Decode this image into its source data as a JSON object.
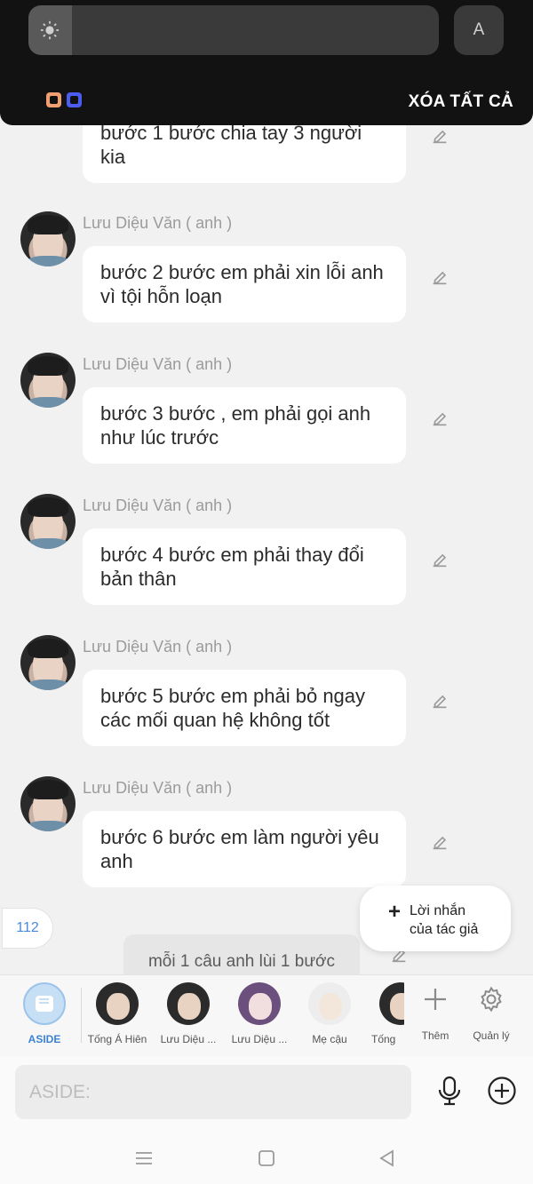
{
  "notification_shade": {
    "auto_label": "A",
    "clear_all_label": "XÓA TẤT CẢ",
    "icons": [
      "sun-icon",
      "app-icon-orange",
      "app-icon-blue"
    ]
  },
  "messages": [
    {
      "sender": "",
      "text": "bước 1 bước chia tay  3 người kia"
    },
    {
      "sender": "Lưu Diệu Văn ( anh )",
      "text": "bước 2 bước em phải xin lỗi anh vì tội hỗn loạn"
    },
    {
      "sender": "Lưu Diệu Văn ( anh )",
      "text": "bước 3 bước , em phải gọi anh như lúc trước"
    },
    {
      "sender": "Lưu Diệu Văn ( anh )",
      "text": "bước 4 bước em phải thay đổi bản thân"
    },
    {
      "sender": "Lưu Diệu Văn ( anh )",
      "text": "bước 5 bước em phải bỏ ngay các mối quan hệ không tốt"
    },
    {
      "sender": "Lưu Diệu Văn ( anh )",
      "text": "bước 6 bước em làm người yêu anh"
    }
  ],
  "narration": {
    "text": "mỗi 1 câu anh lùi 1 bước"
  },
  "message_count": "112",
  "author_note": {
    "line1": "Lời nhắn",
    "line2": "của tác giả"
  },
  "characters": [
    {
      "name": "ASIDE"
    },
    {
      "name": "Tống Á Hiên"
    },
    {
      "name": "Lưu Diệu ..."
    },
    {
      "name": "Lưu Diệu ..."
    },
    {
      "name": "Mẹ cậu"
    },
    {
      "name": "Tống"
    }
  ],
  "tools": {
    "add_label": "Thêm",
    "manage_label": "Quản lý"
  },
  "input": {
    "placeholder": "ASIDE:"
  },
  "colors": {
    "accent": "#3b82d6",
    "shade_bg": "#121212",
    "bubble_bg": "#ffffff",
    "page_bg": "#f1f1f1"
  }
}
